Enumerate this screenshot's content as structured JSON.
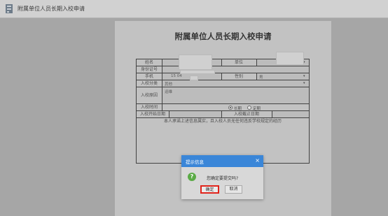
{
  "window": {
    "title": "附属单位人员长期入校申请"
  },
  "form": {
    "title": "附属单位人员长期入校申请",
    "labels": {
      "name": "姓名",
      "unit": "单位",
      "id_no": "身份证号",
      "phone": "手机",
      "gender": "性别",
      "category": "入校分类",
      "reason": "入校原因",
      "time": "入校时间",
      "start_date": "入校开始日期",
      "end_date": "入校截止日期"
    },
    "values": {
      "phone": "15 04",
      "gender": "男",
      "category": "其他",
      "reason": "运维",
      "time_long": "长期",
      "time_fixed": "定期",
      "time_selected": "长期"
    },
    "pledge": "本人承诺上述信息属实，且入校人员无任何违反学校规定的经历"
  },
  "dialog": {
    "title": "提示信息",
    "message": "您确定要提交吗?",
    "ok_label": "确定",
    "cancel_label": "取消"
  },
  "colors": {
    "dialog_header": "#3a86d8",
    "confirm_icon": "#5bab46",
    "highlight": "#e0241b"
  }
}
